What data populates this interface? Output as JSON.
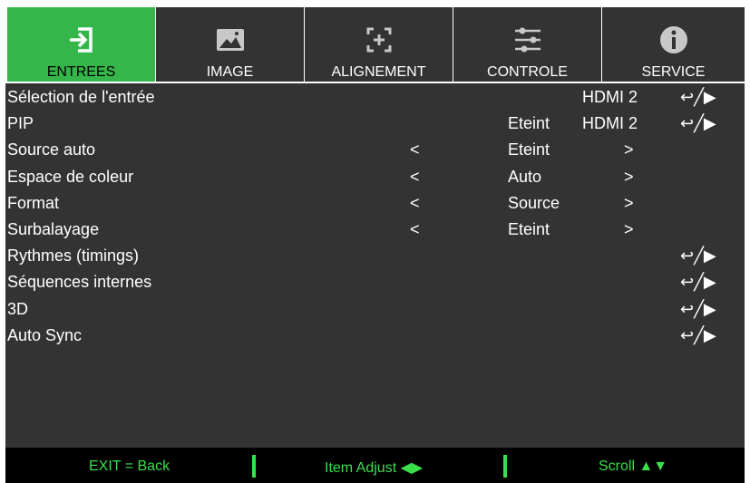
{
  "tabs": [
    {
      "label": "ENTREES",
      "icon": "input-arrow-icon",
      "active": true
    },
    {
      "label": "IMAGE",
      "icon": "picture-icon",
      "active": false
    },
    {
      "label": "ALIGNEMENT",
      "icon": "alignment-icon",
      "active": false
    },
    {
      "label": "CONTROLE",
      "icon": "sliders-icon",
      "active": false
    },
    {
      "label": "SERVICE",
      "icon": "info-icon",
      "active": false
    }
  ],
  "rows": [
    {
      "label": "Sélection de l'entrée",
      "lt": "",
      "val": "",
      "val2": "HDMI 2",
      "gt": "",
      "action": "↩╱▶"
    },
    {
      "label": "PIP",
      "lt": "",
      "val": "Eteint",
      "val2": "HDMI 2",
      "gt": "",
      "action": "↩╱▶"
    },
    {
      "label": "Source auto",
      "lt": "<",
      "val": "Eteint",
      "val2": "",
      "gt": ">",
      "action": ""
    },
    {
      "label": "Espace de coleur",
      "lt": "<",
      "val": "Auto",
      "val2": "",
      "gt": ">",
      "action": ""
    },
    {
      "label": "Format",
      "lt": "<",
      "val": "Source",
      "val2": "",
      "gt": ">",
      "action": ""
    },
    {
      "label": "Surbalayage",
      "lt": "<",
      "val": "Eteint",
      "val2": "",
      "gt": ">",
      "action": ""
    },
    {
      "label": "Rythmes (timings)",
      "lt": "",
      "val": "",
      "val2": "",
      "gt": "",
      "action": "↩╱▶"
    },
    {
      "label": "Séquences internes",
      "lt": "",
      "val": "",
      "val2": "",
      "gt": "",
      "action": "↩╱▶"
    },
    {
      "label": "3D",
      "lt": "",
      "val": "",
      "val2": "",
      "gt": "",
      "action": "↩╱▶"
    },
    {
      "label": "Auto Sync",
      "lt": "",
      "val": "",
      "val2": "",
      "gt": "",
      "action": "↩╱▶"
    }
  ],
  "footer": {
    "exit": "EXIT = Back",
    "adjust": "Item Adjust ◀▶",
    "scroll": "Scroll ▲▼"
  },
  "colors": {
    "accent": "#34b64a",
    "background": "#333333",
    "footer_text": "#39e04b"
  }
}
